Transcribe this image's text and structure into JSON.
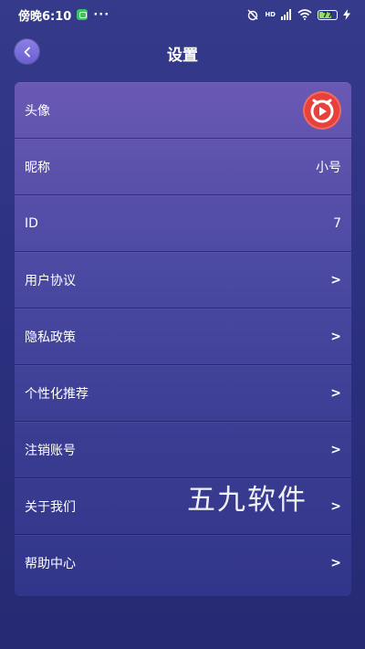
{
  "status_bar": {
    "time": "傍晚6:10",
    "dots": "···",
    "network": "HD",
    "battery_level": "77"
  },
  "nav": {
    "title": "设置"
  },
  "settings": {
    "avatar_label": "头像",
    "nickname_label": "昵称",
    "nickname_value": "小号",
    "id_label": "ID",
    "id_value": "7",
    "user_agreement_label": "用户协议",
    "privacy_policy_label": "隐私政策",
    "personalized_label": "个性化推荐",
    "cancel_account_label": "注销账号",
    "about_label": "关于我们",
    "help_label": "帮助中心",
    "chevron": ">"
  },
  "watermark": {
    "text": "五九软件"
  },
  "colors": {
    "background": "#2c3180",
    "card_top": "#6a59b4",
    "back_button": "#7a6ddc",
    "avatar_red": "#e8413b",
    "battery_green": "#8ee06a"
  }
}
